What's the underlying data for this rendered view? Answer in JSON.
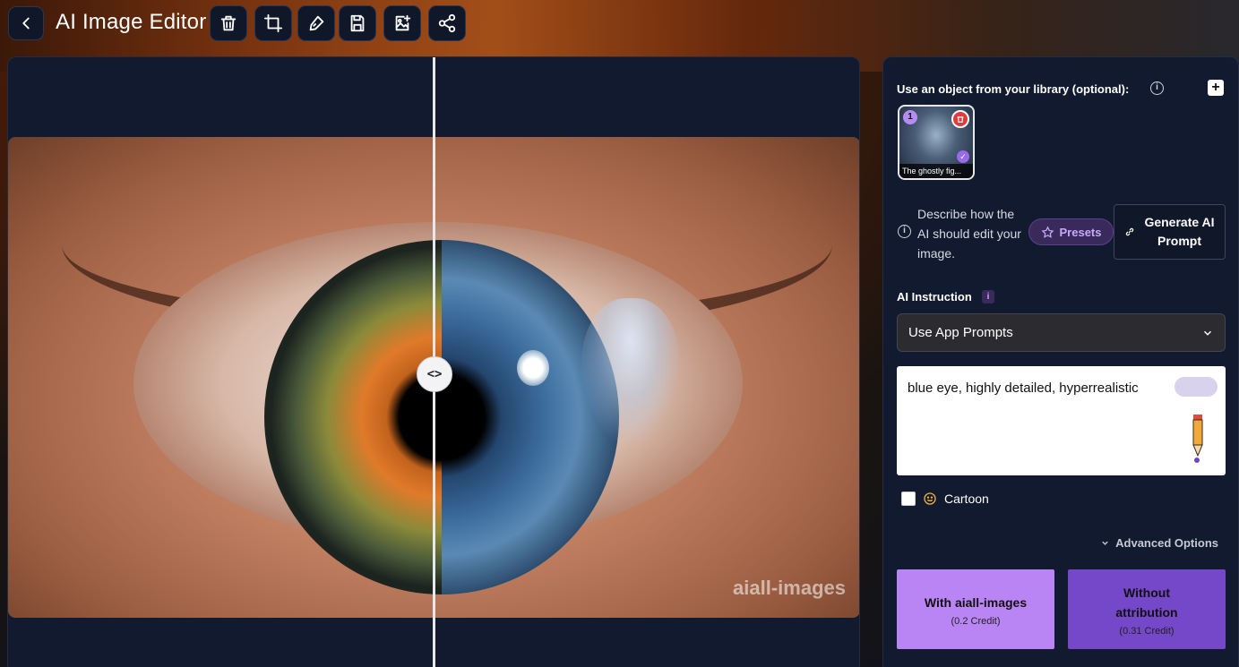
{
  "app": {
    "title": "AI Image Editor"
  },
  "toolbar": {
    "icons": [
      "back-icon",
      "trash-icon",
      "crop-icon",
      "pen-icon",
      "save-icon",
      "add-image-icon",
      "share-icon"
    ]
  },
  "canvas": {
    "watermark": "aiall-images",
    "slider_glyph": "<>"
  },
  "library": {
    "label": "Use an object from your library (optional):",
    "info_glyph": "i",
    "add_glyph": "+",
    "items": [
      {
        "index": "1",
        "caption": "The ghostly fig..."
      }
    ]
  },
  "describe": {
    "info_glyph": "i",
    "text": "Describe how the AI should edit your image.",
    "presets_label": "Presets",
    "generate_label": "Generate AI Prompt"
  },
  "instruction": {
    "label": "AI Instruction",
    "info_glyph": "i",
    "selected_option": "Use App Prompts",
    "prompt_value": "blue eye, highly detailed, hyperrealistic"
  },
  "style": {
    "cartoon_label": "Cartoon",
    "cartoon_checked": false
  },
  "advanced": {
    "label": "Advanced Options"
  },
  "actions": {
    "with_label": "With aiall-images",
    "with_cost": "(0.2 Credit)",
    "without_label": "Without attribution",
    "without_cost": "(0.31 Credit)"
  },
  "colors": {
    "accent_light": "#b985f5",
    "accent_dark": "#7448c8",
    "panel_bg": "#111a2e"
  }
}
